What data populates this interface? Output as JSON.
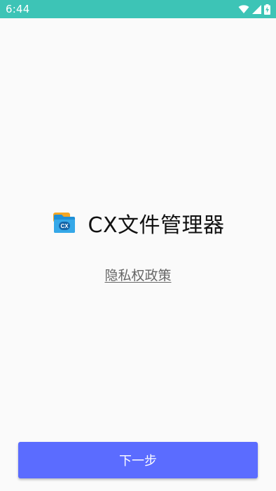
{
  "status_bar": {
    "time": "6:44",
    "icons": [
      "wifi-icon",
      "signal-icon",
      "battery-charging-icon"
    ]
  },
  "app": {
    "name": "CX文件管理器",
    "logo_icon": "cx-folder-logo-icon",
    "logo_text": "CX"
  },
  "privacy": {
    "link_label": "隐私权政策"
  },
  "footer": {
    "next_label": "下一步"
  },
  "colors": {
    "status_bar": "#3dc4b6",
    "background": "#fafafa",
    "button": "#5b6cff",
    "link": "#666666"
  }
}
